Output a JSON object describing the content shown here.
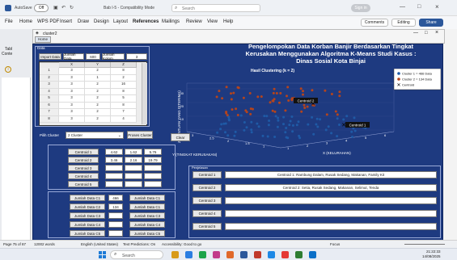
{
  "word": {
    "autosave_label": "AutoSave",
    "autosave_state": "Off",
    "doc_name": "Bab I-5 - Compatibility Mode",
    "search_placeholder": "Search",
    "signin_label": "Sign in",
    "menu": [
      "File",
      "Home",
      "WPS PDF",
      "Insert",
      "Draw",
      "Design",
      "Layout",
      "References",
      "Mailings",
      "Review",
      "View",
      "Help"
    ],
    "comments_label": "Comments",
    "editing_label": "Editing",
    "share_label": "Share",
    "sidebar_text_1": "Tabl",
    "sidebar_text_2": "Conte",
    "status_page": "Page 75 of 87",
    "status_words": "12002 words",
    "status_lang": "English (United States)",
    "status_predict": "Text Predictions: On",
    "status_access": "Accessibility: Good to go",
    "status_focus": "Focus",
    "status_time": "21:22:33",
    "status_date": "14/08/2025"
  },
  "taskbar": {
    "search_placeholder": "Search",
    "time": "21:22:33",
    "date": "14/08/2025"
  },
  "app": {
    "window_title": "cluster2",
    "tab_label": "Home",
    "title_line1": "Pengelompokan Data Korban Banjir Berdasarkan Tingkat",
    "title_line2": "Kerusakan Menggunakan Algoritma K-Means Studi Kasus :",
    "title_line3": "Dinas Sosial Kota Binjai",
    "data_panel_label": "Data",
    "import_btn": "Import Data",
    "jumlah_data_label": "Jumlah Data",
    "jumlah_data_value": "600",
    "jumlah_kolom_label": "Jumlah Kolom",
    "jumlah_kolom_value": "3",
    "table_headers": [
      "",
      "X",
      "Y",
      "Z"
    ],
    "table_rows": [
      [
        "1",
        "3",
        "2",
        "8"
      ],
      [
        "2",
        "3",
        "1",
        "2"
      ],
      [
        "3",
        "3",
        "2",
        "16"
      ],
      [
        "4",
        "3",
        "2",
        "8"
      ],
      [
        "5",
        "3",
        "2",
        "5"
      ],
      [
        "6",
        "3",
        "2",
        "8"
      ],
      [
        "7",
        "3",
        "2",
        "7"
      ],
      [
        "8",
        "3",
        "2",
        "4"
      ]
    ],
    "pilih_cluster_label": "Pilih Cluster",
    "cluster_select_value": "2 Cluster",
    "proses_btn": "Proses Cluster",
    "clear_btn": "Clear",
    "centroid_labels": [
      "Centroid 1",
      "Centroid 2",
      "Centroid 3",
      "Centroid 4",
      "Centroid 5"
    ],
    "centroid_values": [
      [
        "4.62",
        "1.62",
        "5.76"
      ],
      [
        "3.46",
        "2.16",
        "19.79"
      ]
    ],
    "jumlah_labels_left": [
      "Jumlah Data C1",
      "Jumlah Data C2",
      "Jumlah Data C3",
      "Jumlah Data C4",
      "Jumlah Data C5"
    ],
    "jumlah_values": [
      "466",
      "134"
    ],
    "jumlah_labels_right": [
      "Jumlah Data C1",
      "Jumlah Data C1",
      "Jumlah Data C3",
      "Jumlah Data C4",
      "Jumlah Data C5"
    ],
    "penjelasan_label": "Penjelasan",
    "penjelasan_rows": [
      {
        "label": "Centroid 1",
        "text": "Centroid 1: Rambung Dalam, Rusak Sedang, Makanan, Family Kit"
      },
      {
        "label": "Centroid 2",
        "text": "Centroid 2: Setia, Rusak Sedang, Makanan, Selimut, Tenda"
      },
      {
        "label": "Centroid 3",
        "text": ""
      },
      {
        "label": "Centroid 4",
        "text": ""
      },
      {
        "label": "Centroid 5",
        "text": ""
      }
    ]
  },
  "chart_data": {
    "type": "scatter",
    "title": "Hasil Clustering (k = 2)",
    "xlabel": "X (KELURAHAN)",
    "ylabel": "Y (TINGKAT KERUSAKAN)",
    "zlabel": "Z (BANTUAN YANG DITERIMA)",
    "z_ticks": [
      "10",
      "20",
      "30"
    ],
    "y_ticks": [
      "3",
      "2.5",
      "2",
      "1.5",
      "1"
    ],
    "x_ticks": [
      "1",
      "2",
      "3",
      "4",
      "5",
      "6"
    ],
    "legend": [
      "Cluster 1 = 466 Data",
      "Cluster 2 = 134 Data",
      "Centroid"
    ],
    "legend_position": "top-right",
    "centroid_annotations": [
      "Centroid 2",
      "Centroid 1"
    ],
    "colors": {
      "cluster1": "#1f5aa6",
      "cluster2": "#b5441c",
      "centroid": "#000000"
    }
  }
}
